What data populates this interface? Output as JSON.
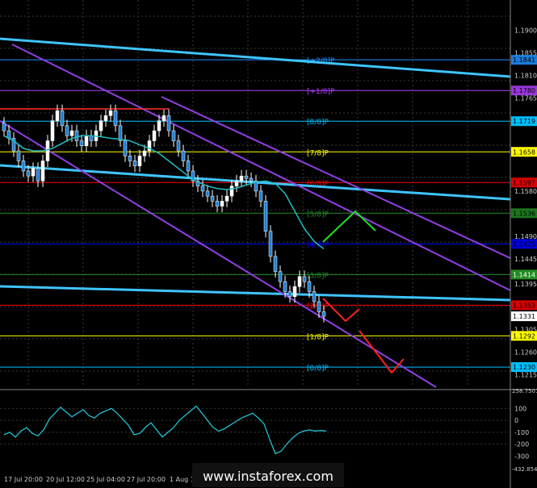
{
  "chart_data": {
    "type": "candlestick",
    "instrument": "EUR/USD",
    "grid": true,
    "background": "#000000",
    "price_axis": {
      "ylim": [
        1.119,
        1.196
      ],
      "ticks": [
        "1.1900",
        "1.1855",
        "1.1810",
        "1.1765",
        "1.1580",
        "1.1490",
        "1.1445",
        "1.1395",
        "1.1305",
        "1.1260",
        "1.1215"
      ]
    },
    "price_tags": [
      {
        "value": "1.1719",
        "color": "#00bfff",
        "text": "#000000"
      },
      {
        "value": "1.1658",
        "color": "#ffff00",
        "text": "#000000"
      },
      {
        "value": "1.1597",
        "color": "#ff0000",
        "text": "#ff0000",
        "dim": true
      },
      {
        "value": "1.1536",
        "color": "#228b22",
        "text": "#228b22",
        "dim": true
      },
      {
        "value": "1.1475",
        "color": "#0000ff",
        "text": "#0000ff",
        "dim": true
      },
      {
        "value": "1.1414",
        "color": "#228b22",
        "text": "#ffffff"
      },
      {
        "value": "1.1353",
        "color": "#ff0000",
        "text": "#ff0000",
        "dim": true
      },
      {
        "value": "1.1331",
        "color": "#ffffff",
        "text": "#000000"
      },
      {
        "value": "1.1292",
        "color": "#ffff00",
        "text": "#000000"
      },
      {
        "value": "1.1230",
        "color": "#00bfff",
        "text": "#000000"
      },
      {
        "value": "1.1780",
        "color": "#b040ff",
        "text": "#b040ff",
        "dim": true
      },
      {
        "value": "1.1841",
        "color": "#1e90ff",
        "text": "#1e90ff",
        "dim": true
      }
    ],
    "murrey_levels": [
      {
        "label": "[8/8]P",
        "value": 1.1719,
        "color": "#00bfff"
      },
      {
        "label": "[7/8]P",
        "value": 1.1658,
        "color": "#ffff00"
      },
      {
        "label": "[6/8]P",
        "value": 1.1597,
        "color": "#ff0000"
      },
      {
        "label": "[5/8]P",
        "value": 1.1536,
        "color": "#228b22"
      },
      {
        "label": "[4/8]P",
        "value": 1.1475,
        "color": "#0000ff"
      },
      {
        "label": "[3/8]P",
        "value": 1.1414,
        "color": "#228b22"
      },
      {
        "label": "[2/8]P",
        "value": 1.1353,
        "color": "#ff0000"
      },
      {
        "label": "[1/8]P",
        "value": 1.1292,
        "color": "#ffff00"
      },
      {
        "label": "[0/8]P",
        "value": 1.123,
        "color": "#00bfff"
      },
      {
        "label": "[+1/8]P",
        "value": 1.178,
        "color": "#b040ff"
      },
      {
        "label": "[+2/8]P",
        "value": 1.1841,
        "color": "#1e90ff"
      }
    ],
    "time_labels": [
      "17 Jul 20:00",
      "20 Jul 12:00",
      "25 Jul 04:00",
      "27 Jul 20:00",
      "1 Aug 12:00"
    ],
    "close_series": [
      1.17,
      1.1685,
      1.166,
      1.164,
      1.162,
      1.161,
      1.1625,
      1.16,
      1.164,
      1.168,
      1.172,
      1.174,
      1.171,
      1.169,
      1.17,
      1.168,
      1.167,
      1.169,
      1.168,
      1.17,
      1.172,
      1.173,
      1.174,
      1.171,
      1.168,
      1.165,
      1.164,
      1.163,
      1.165,
      1.166,
      1.168,
      1.17,
      1.172,
      1.173,
      1.17,
      1.168,
      1.166,
      1.164,
      1.162,
      1.16,
      1.159,
      1.158,
      1.157,
      1.156,
      1.155,
      1.156,
      1.157,
      1.159,
      1.16,
      1.161,
      1.1605,
      1.16,
      1.158,
      1.156,
      1.15,
      1.145,
      1.142,
      1.14,
      1.138,
      1.137,
      1.139,
      1.141,
      1.14,
      1.138,
      1.136,
      1.134,
      1.1331
    ],
    "ma_series": [
      1.169,
      1.168,
      1.1665,
      1.166,
      1.166,
      1.1665,
      1.1675,
      1.1685,
      1.169,
      1.169,
      1.1688,
      1.1685,
      1.1683,
      1.168,
      1.1672,
      1.1665,
      1.1655,
      1.164,
      1.1625,
      1.161,
      1.1598,
      1.159,
      1.1585,
      1.1583,
      1.1586,
      1.1592,
      1.1598,
      1.16,
      1.1595,
      1.1575,
      1.154,
      1.1505,
      1.148,
      1.1465
    ],
    "oscillator": {
      "name": "CCI",
      "ylim": [
        -432.8544,
        258.7501
      ],
      "ticks": [
        "100",
        "0",
        "-100",
        "-200",
        "-300"
      ],
      "min_label": "-432.8544",
      "max_label": "258.7501",
      "values": [
        -120,
        -100,
        -140,
        -90,
        -60,
        -110,
        -130,
        -80,
        10,
        60,
        110,
        70,
        30,
        60,
        90,
        40,
        20,
        60,
        80,
        100,
        60,
        10,
        -40,
        -120,
        -110,
        -60,
        -20,
        -80,
        -140,
        -100,
        -60,
        0,
        40,
        80,
        120,
        60,
        0,
        -60,
        -90,
        -70,
        -40,
        -10,
        20,
        40,
        60,
        20,
        -30,
        -160,
        -280,
        -260,
        -200,
        -150,
        -110,
        -90,
        -80,
        -90,
        -85,
        -90
      ]
    }
  },
  "watermark": "www.instaforex.com"
}
